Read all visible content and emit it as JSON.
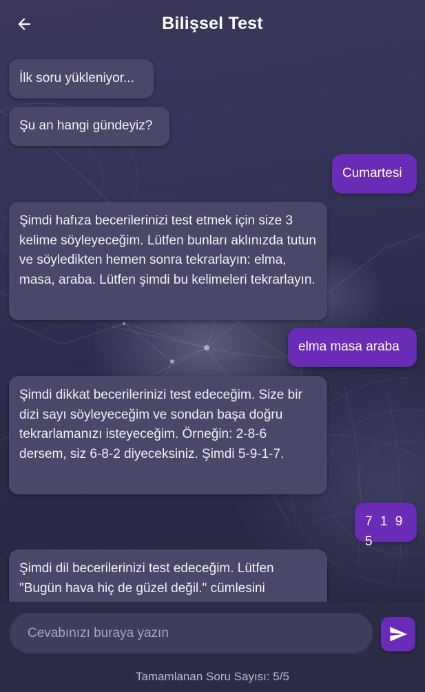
{
  "header": {
    "title": "Bilişsel Test"
  },
  "messages": [
    {
      "role": "bot",
      "text": "İlk soru yükleniyor..."
    },
    {
      "role": "bot",
      "text": "Şu an hangi gündeyiz?"
    },
    {
      "role": "user",
      "text": "Cumartesi"
    },
    {
      "role": "bot",
      "text": "Şimdi hafıza becerilerinizi test etmek için size 3 kelime söyleyeceğim. Lütfen bunları aklınızda tutun ve söyledikten hemen sonra tekrarlayın: elma, masa, araba. Lütfen şimdi bu kelimeleri tekrarlayın."
    },
    {
      "role": "user",
      "text": "elma masa araba"
    },
    {
      "role": "bot",
      "text": "Şimdi dikkat becerilerinizi test edeceğim. Size bir dizi sayı söyleyeceğim ve sondan başa doğru tekrarlamanızı isteyeceğim. Örneğin: 2-8-6 dersem, siz 6-8-2 diyeceksiniz. Şimdi 5-9-1-7."
    },
    {
      "role": "user",
      "text": "7 1 9 5"
    },
    {
      "role": "bot",
      "text": "Şimdi dil becerilerinizi test edeceğim. Lütfen \"Bugün hava hiç de güzel değil.\" cümlesini"
    }
  ],
  "input": {
    "placeholder": "Cevabınızı buraya yazın",
    "value": ""
  },
  "footer": {
    "progress_text": "Tamamlanan Soru Sayısı: 5/5"
  },
  "icons": {
    "back": "arrow-left-icon",
    "send": "send-icon"
  },
  "colors": {
    "accent": "#6a2bb6",
    "bot_bubble": "#4a4868",
    "background": "#2f2f4e"
  }
}
